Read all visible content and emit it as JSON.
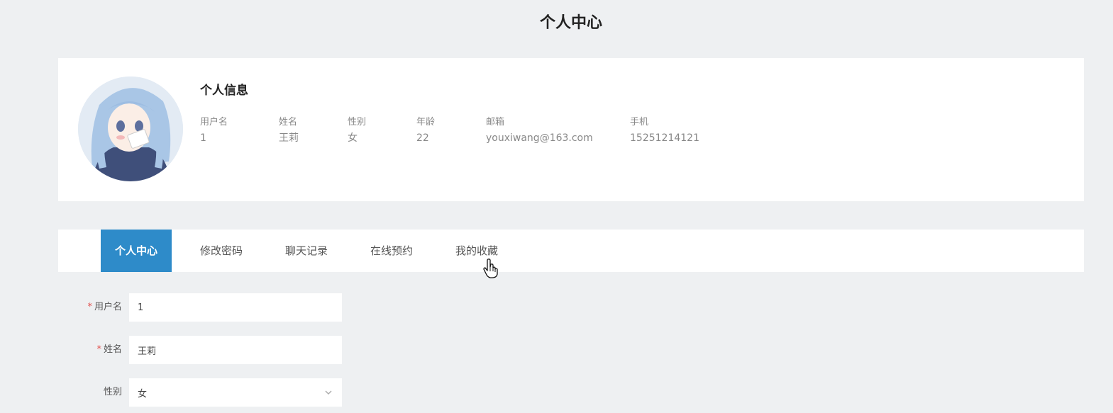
{
  "page": {
    "title": "个人中心"
  },
  "profile": {
    "section_title": "个人信息",
    "fields": [
      {
        "label": "用户名",
        "value": "1"
      },
      {
        "label": "姓名",
        "value": "王莉"
      },
      {
        "label": "性别",
        "value": "女"
      },
      {
        "label": "年龄",
        "value": "22"
      },
      {
        "label": "邮箱",
        "value": "youxiwang@163.com"
      },
      {
        "label": "手机",
        "value": "15251214121"
      }
    ]
  },
  "tabs": [
    {
      "label": "个人中心",
      "active": true
    },
    {
      "label": "修改密码",
      "active": false
    },
    {
      "label": "聊天记录",
      "active": false
    },
    {
      "label": "在线预约",
      "active": false
    },
    {
      "label": "我的收藏",
      "active": false
    }
  ],
  "form": {
    "required_mark": "*",
    "username": {
      "label": "用户名",
      "value": "1"
    },
    "name": {
      "label": "姓名",
      "value": "王莉"
    },
    "gender": {
      "label": "性别",
      "value": "女"
    }
  },
  "colors": {
    "accent": "#2e8bc9",
    "background": "#eef0f2",
    "required": "#e2524f"
  }
}
